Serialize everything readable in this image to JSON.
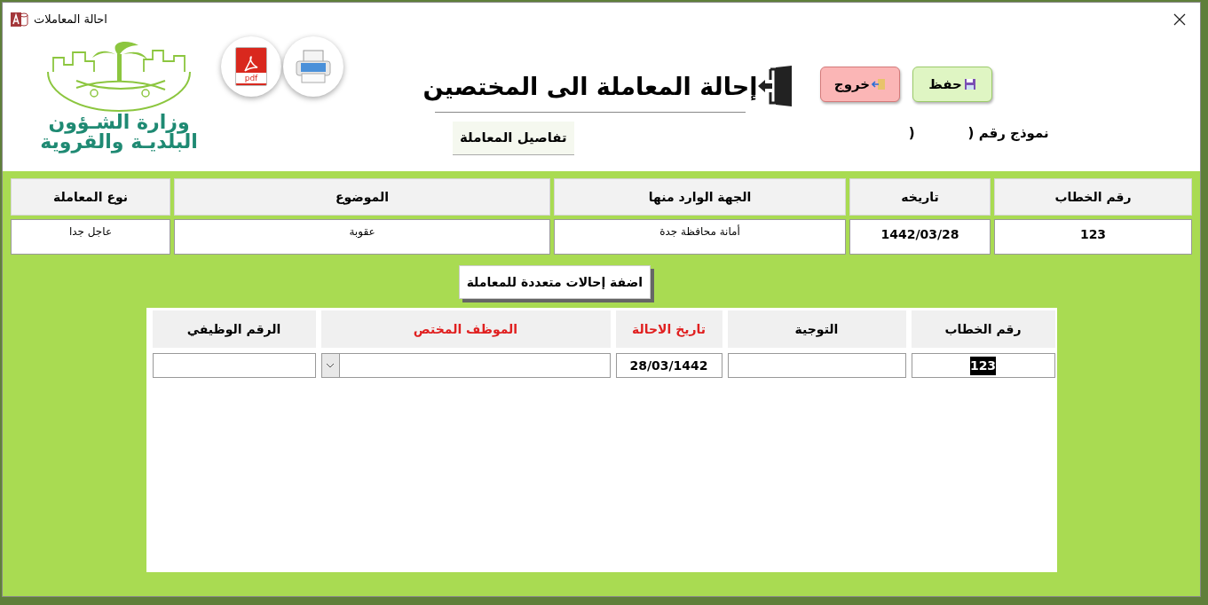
{
  "window": {
    "title": "احالة المعاملات"
  },
  "logo": {
    "lines": [
      "وزارة الشـؤون",
      "البلديـة والقروية"
    ]
  },
  "tools": [
    {
      "kind": "pdf",
      "label": "pdf"
    },
    {
      "kind": "print"
    }
  ],
  "heading": "إحالة المعاملة الى المختصين",
  "buttons": [
    {
      "kind": "save",
      "label": "حفظ"
    },
    {
      "kind": "exit",
      "label": "خروج"
    }
  ],
  "form_number": {
    "label": "نموذج رقم (",
    "close": ")"
  },
  "section_tab": "تفاصيل المعاملة",
  "details": [
    {
      "label": "رقم الخطاب",
      "value": "123",
      "bold": true
    },
    {
      "label": "تاريخه",
      "value": "1442/03/28",
      "bold": true
    },
    {
      "label": "الجهة الوارد منها",
      "value": "أمانة محافظة جدة",
      "bold": false
    },
    {
      "label": "الموضوع",
      "value": "عقوبة",
      "bold": false
    },
    {
      "label": "نوع المعاملة",
      "value": "عاجل جدا",
      "bold": false
    }
  ],
  "add_button": "اضفة إحالات متعددة للمعاملة",
  "referrals": {
    "columns": [
      {
        "label": "رقم الخطاب",
        "required": false
      },
      {
        "label": "التوجية",
        "required": false
      },
      {
        "label": "تاريخ الاحالة",
        "required": true
      },
      {
        "label": "الموظف المختص",
        "required": true
      },
      {
        "label": "الرقم الوظيفي",
        "required": false
      }
    ],
    "row": [
      {
        "kind": "text",
        "value": "123",
        "highlighted": true
      },
      {
        "kind": "text"
      },
      {
        "kind": "text",
        "value": "28/03/1442",
        "highlighted": false
      },
      {
        "kind": "dropdown"
      },
      {
        "kind": "text"
      }
    ]
  }
}
